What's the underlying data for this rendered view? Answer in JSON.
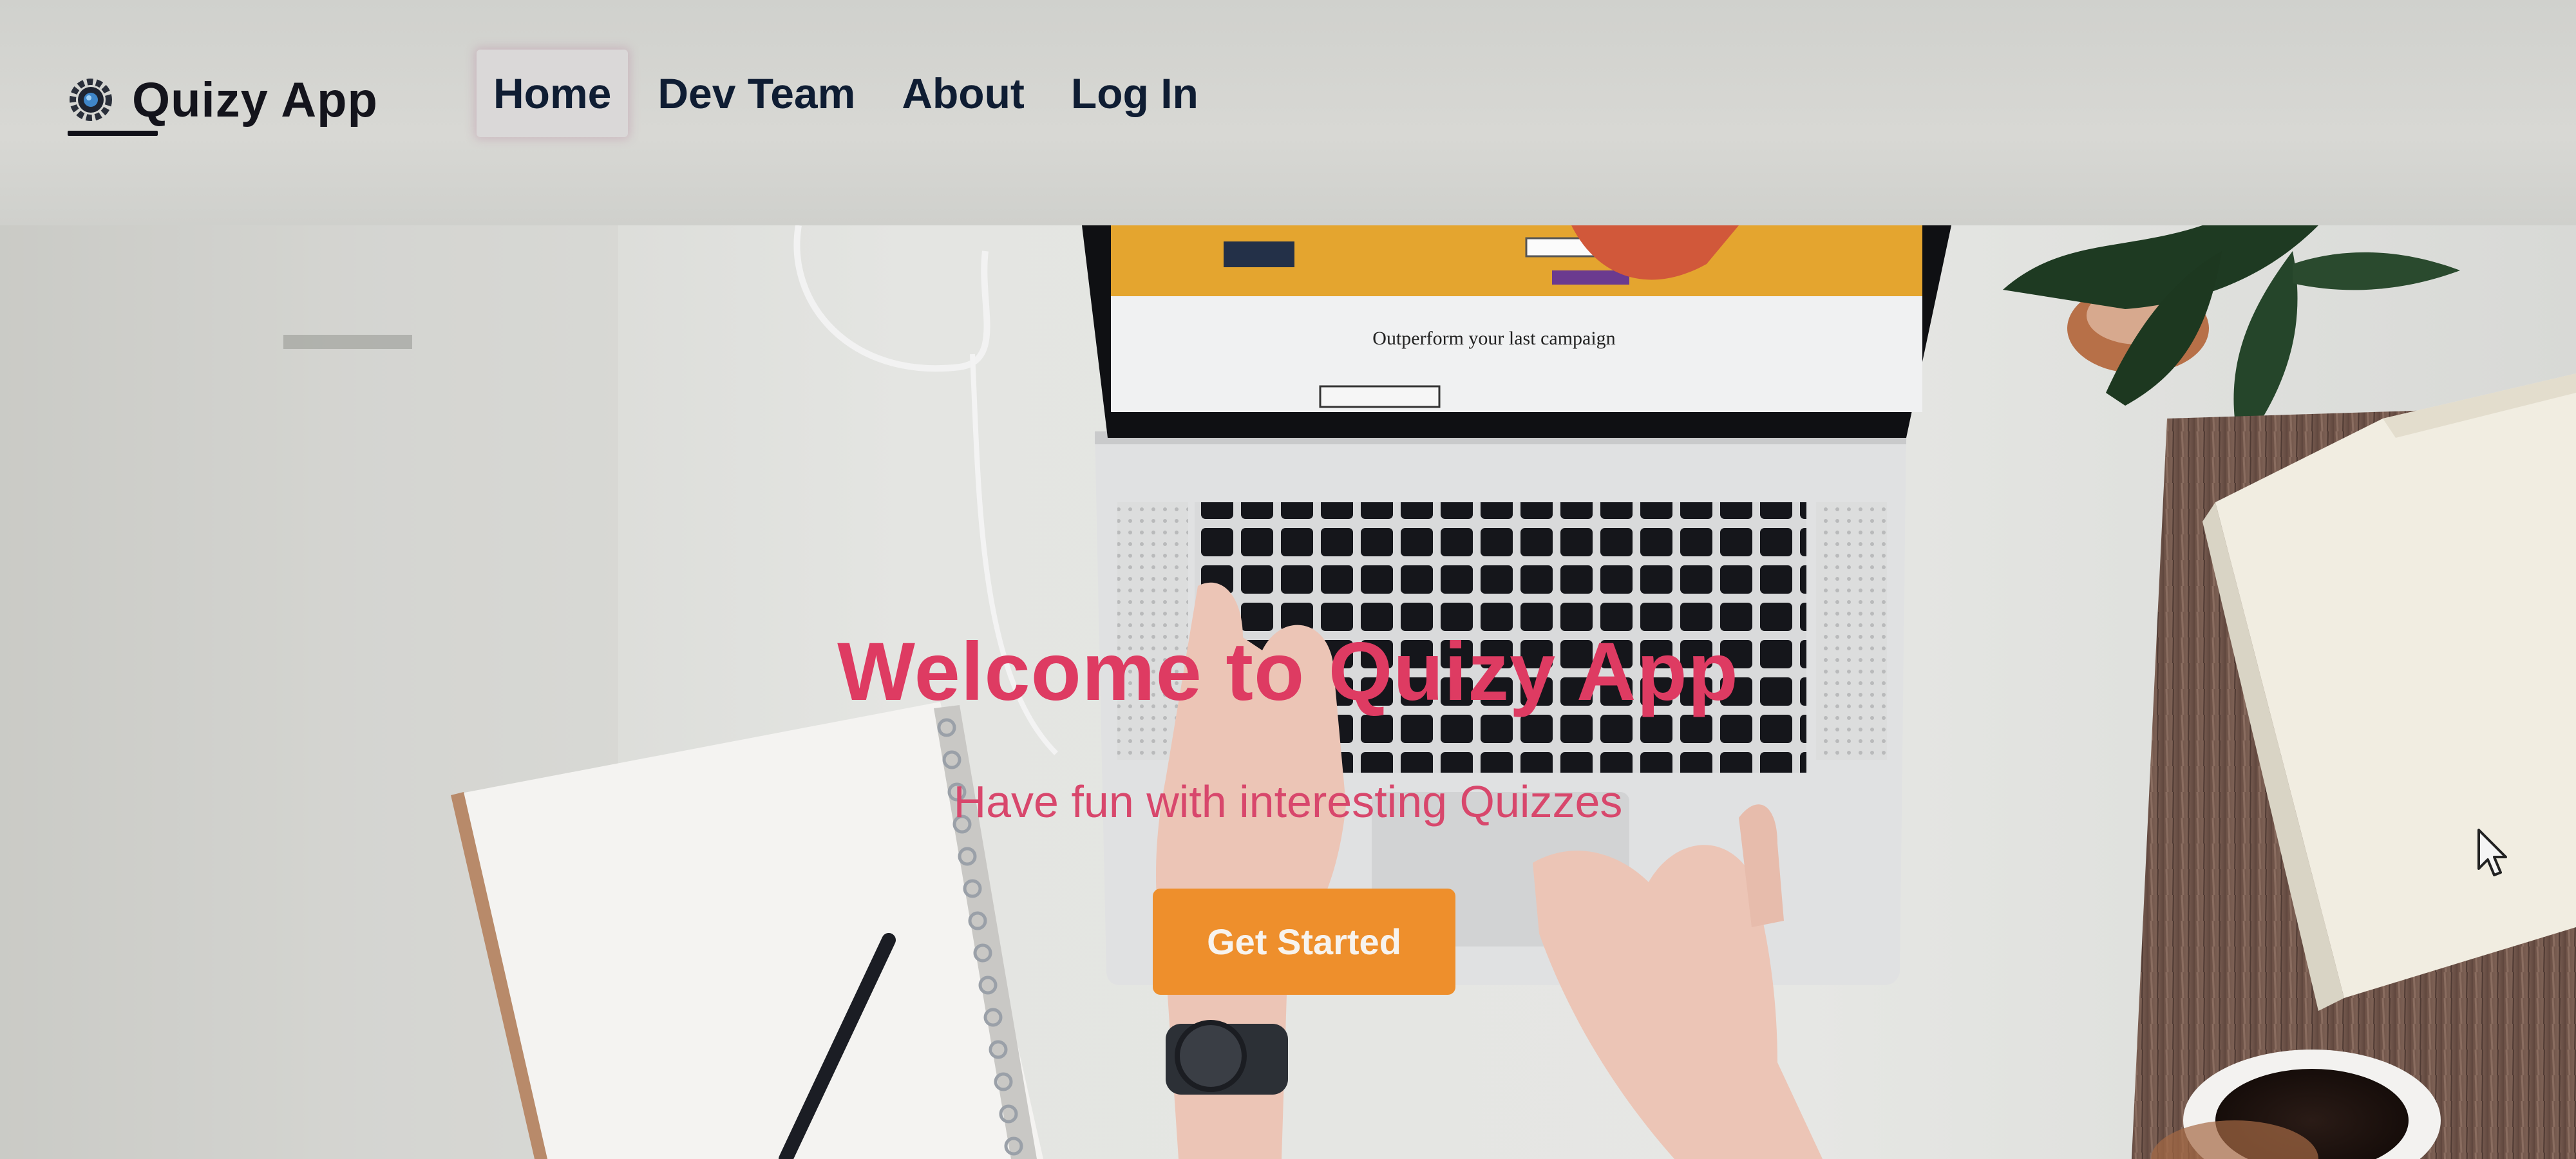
{
  "app": {
    "name": "Quizy App",
    "logo_icon": "quiz-gear-icon"
  },
  "nav": {
    "items": [
      {
        "label": "Home",
        "active": true
      },
      {
        "label": "Dev Team",
        "active": false
      },
      {
        "label": "About",
        "active": false
      },
      {
        "label": "Log In",
        "active": false
      }
    ]
  },
  "hero": {
    "title": "Welcome to Quizy App",
    "subtitle": "Have fun with interesting Quizzes",
    "cta_label": "Get Started",
    "laptop_screen_text": "Outperform your last campaign"
  },
  "colors": {
    "title": "#de3b62",
    "subtitle": "#d8476c",
    "cta": "#ee8f2c",
    "nav_text": "#0f1d33"
  }
}
